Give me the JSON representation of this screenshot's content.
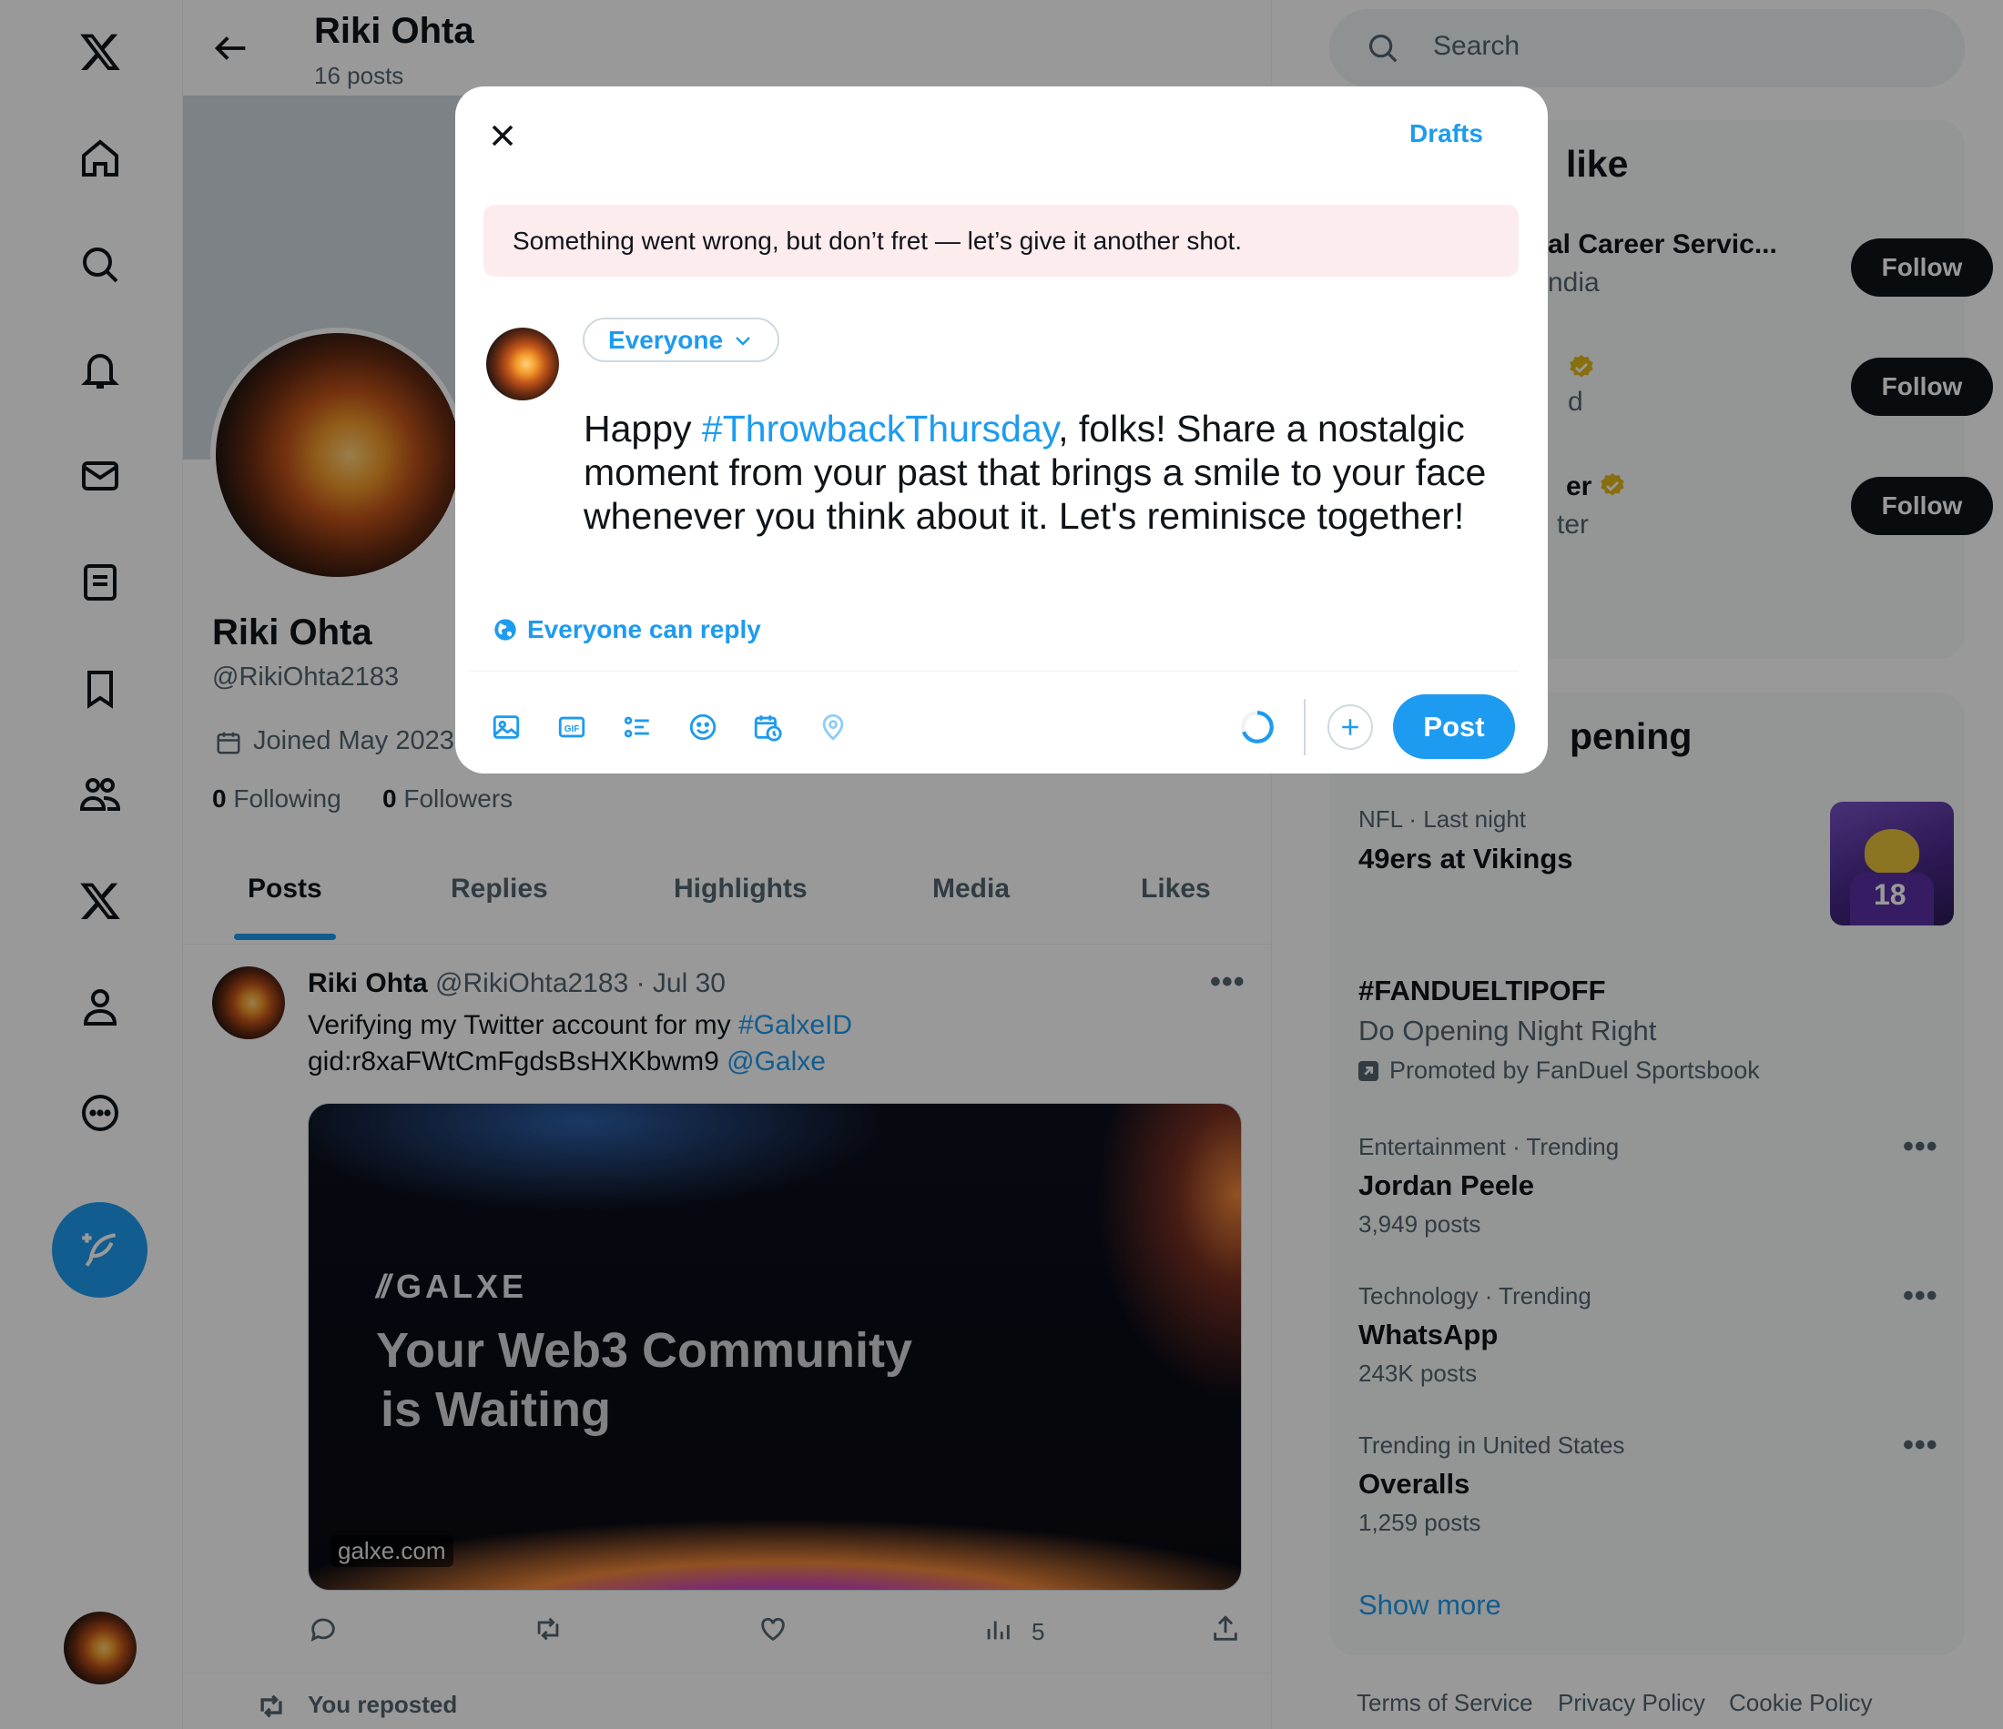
{
  "profile": {
    "name": "Riki Ohta",
    "post_count": "16 posts",
    "handle": "@RikiOhta2183",
    "joined": "Joined May 2023",
    "following_count": "0",
    "following_label": "Following",
    "followers_count": "0",
    "followers_label": "Followers"
  },
  "tabs": [
    "Posts",
    "Replies",
    "Highlights",
    "Media",
    "Likes"
  ],
  "post": {
    "author": "Riki Ohta",
    "handle_date": "@RikiOhta2183 · Jul 30",
    "text_line1": "Verifying my Twitter account for my ",
    "hashtag": "#GalxeID",
    "text_line2": "gid:r8xaFWtCmFgdsBsHXKbwm9 ",
    "mention": "@Galxe",
    "card_brand": "GALXE",
    "card_headline_1": "Your Web3 Community",
    "card_headline_2": "is Waiting",
    "card_domain": "galxe.com",
    "views": "5",
    "reposted_label": "You reposted"
  },
  "search": {
    "placeholder": "Search"
  },
  "who_to_follow": {
    "title_fragment": "like",
    "items": [
      {
        "name_fragment": "al Career Servic...",
        "sub_fragment": "ndia",
        "button": "Follow"
      },
      {
        "name_fragment": "",
        "sub_fragment": "d",
        "button": "Follow"
      },
      {
        "name_fragment": "er",
        "sub_fragment": "ter",
        "button": "Follow"
      }
    ]
  },
  "trends": {
    "title_fragment": "pening",
    "items": [
      {
        "meta": "NFL · Last night",
        "title": "49ers at Vikings",
        "sub": ""
      },
      {
        "meta": "",
        "title": "#FANDUELTIPOFF",
        "sub": "Do Opening Night Right",
        "promo": "Promoted by FanDuel Sportsbook"
      },
      {
        "meta": "Entertainment · Trending",
        "title": "Jordan Peele",
        "sub": "3,949 posts"
      },
      {
        "meta": "Technology · Trending",
        "title": "WhatsApp",
        "sub": "243K posts"
      },
      {
        "meta": "Trending in United States",
        "title": "Overalls",
        "sub": "1,259 posts"
      }
    ],
    "show_more": "Show more"
  },
  "footer": {
    "links": [
      "Terms of Service",
      "Privacy Policy",
      "Cookie Policy"
    ]
  },
  "modal": {
    "drafts_label": "Drafts",
    "error_text": "Something went wrong, but don’t fret — let’s give it another shot.",
    "audience": "Everyone",
    "compose_pre": "Happy ",
    "compose_tag": "#ThrowbackThursday",
    "compose_post": ", folks! Share a nostalgic moment from your past that brings a smile to your face whenever you think about it. Let's reminisce together!",
    "reply_setting": "Everyone can reply",
    "post_button": "Post"
  },
  "colors": {
    "accent": "#1d9bf0",
    "text": "#0f1419",
    "muted": "#536471",
    "error_bg": "#fdecee",
    "verified": "#e2b719"
  }
}
